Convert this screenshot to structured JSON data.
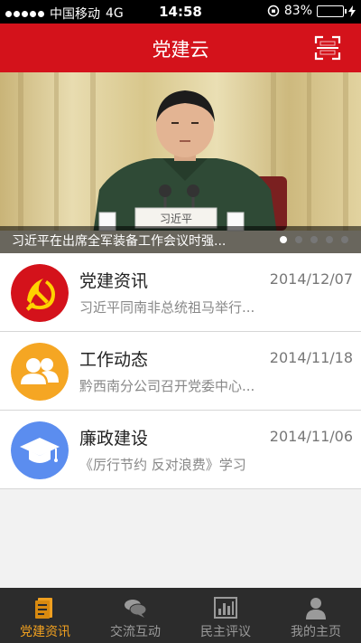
{
  "status_bar": {
    "carrier": "中国移动",
    "network": "4G",
    "time": "14:58",
    "battery": "83%",
    "battery_level": 0.83
  },
  "header": {
    "title": "党建云",
    "scan_icon": "scan-icon"
  },
  "banner": {
    "caption": "习近平在出席全军装备工作会议时强...",
    "nameplate": "习近平",
    "slide_count": 5,
    "active_slide": 1
  },
  "news_list": [
    {
      "title": "党建资讯",
      "date": "2014/12/07",
      "desc": "习近平同南非总统祖马举行...",
      "icon": "party-emblem-icon",
      "color": "#d4121b"
    },
    {
      "title": "工作动态",
      "date": "2014/11/18",
      "desc": "黔西南分公司召开党委中心...",
      "icon": "people-icon",
      "color": "#f5a623"
    },
    {
      "title": "廉政建设",
      "date": "2014/11/06",
      "desc": "《厉行节约 反对浪费》学习",
      "icon": "graduation-cap-icon",
      "color": "#5b8def"
    }
  ],
  "tabs": [
    {
      "label": "党建资讯",
      "icon": "document-icon",
      "active": true
    },
    {
      "label": "交流互动",
      "icon": "chat-icon",
      "active": false
    },
    {
      "label": "民主评议",
      "icon": "bar-chart-icon",
      "active": false
    },
    {
      "label": "我的主页",
      "icon": "user-icon",
      "active": false
    }
  ],
  "colors": {
    "brand_red": "#d4121b",
    "tab_active": "#f0a020",
    "tab_bar_bg": "#2c2c2c"
  }
}
